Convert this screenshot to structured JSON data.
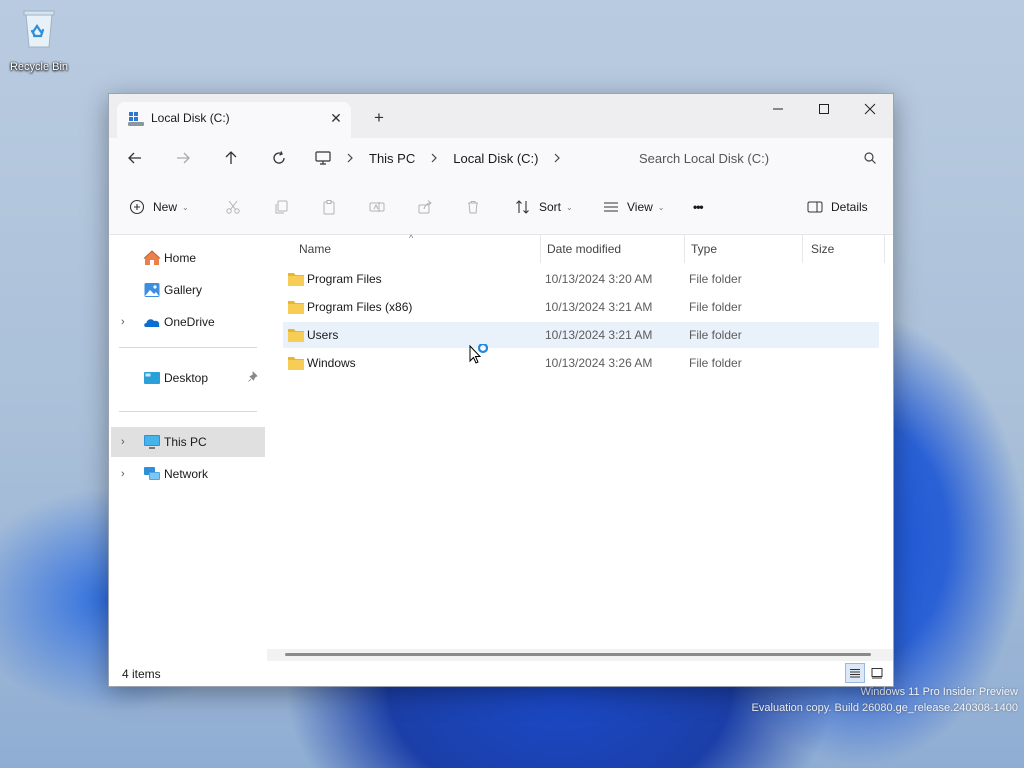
{
  "desktop": {
    "recycle_bin_label": "Recycle Bin",
    "watermark_line1": "Windows 11 Pro Insider Preview",
    "watermark_line2": "Evaluation copy. Build 26080.ge_release.240308-1400"
  },
  "window": {
    "tab_title": "Local Disk (C:)",
    "tab_close": "✕",
    "new_tab": "+"
  },
  "address": {
    "breadcrumbs": [
      "This PC",
      "Local Disk (C:)"
    ],
    "search_placeholder": "Search Local Disk (C:)"
  },
  "toolbar": {
    "new_label": "New",
    "sort_label": "Sort",
    "view_label": "View",
    "more_label": "•••",
    "details_label": "Details"
  },
  "sidebar": {
    "items": [
      {
        "label": "Home",
        "icon": "home-icon"
      },
      {
        "label": "Gallery",
        "icon": "gallery-icon"
      },
      {
        "label": "OneDrive",
        "icon": "onedrive-icon",
        "expandable": true
      },
      {
        "label": "Desktop",
        "icon": "desktop-folder-icon",
        "pinned": true
      },
      {
        "label": "This PC",
        "icon": "this-pc-icon",
        "expandable": true,
        "selected": true
      },
      {
        "label": "Network",
        "icon": "network-icon",
        "expandable": true
      }
    ]
  },
  "columns": {
    "name": "Name",
    "date": "Date modified",
    "type": "Type",
    "size": "Size"
  },
  "files": [
    {
      "name": "Program Files",
      "date": "10/13/2024 3:20 AM",
      "type": "File folder"
    },
    {
      "name": "Program Files (x86)",
      "date": "10/13/2024 3:21 AM",
      "type": "File folder"
    },
    {
      "name": "Users",
      "date": "10/13/2024 3:21 AM",
      "type": "File folder",
      "hovered": true
    },
    {
      "name": "Windows",
      "date": "10/13/2024 3:26 AM",
      "type": "File folder"
    }
  ],
  "status": {
    "item_count": "4 items"
  },
  "colors": {
    "accent": "#0067c0",
    "folder": "#f4c443",
    "selection": "#e0e0e0",
    "hover_row": "#e9f1fb"
  }
}
